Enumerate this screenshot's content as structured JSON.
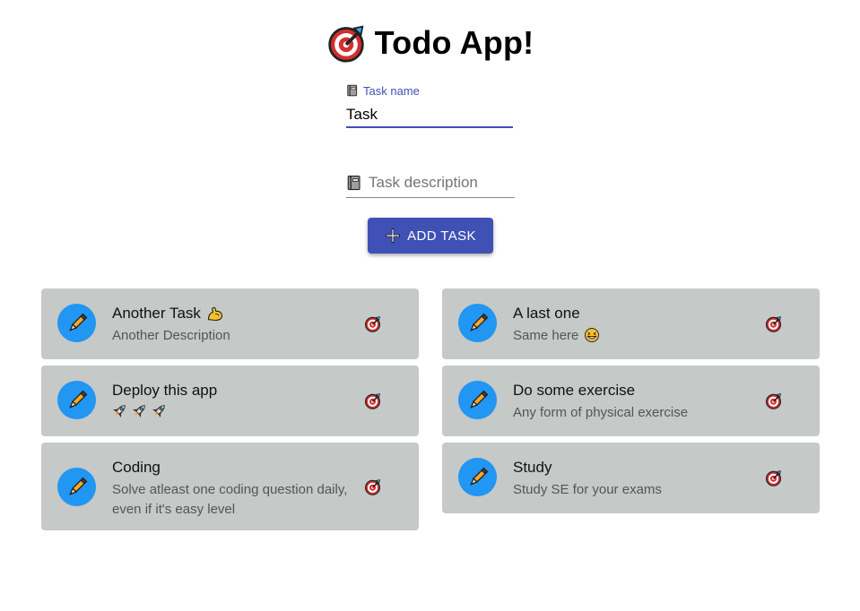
{
  "app": {
    "title": "Todo App!",
    "logo_icon": "target-dart-icon"
  },
  "form": {
    "name_label": "Task name",
    "name_value": "Task",
    "description_placeholder": "Task description",
    "field_icon": "notebook-icon",
    "add_button_label": "ADD TASK",
    "add_button_icon": "plus-icon"
  },
  "colors": {
    "primary": "#3f51b5",
    "avatar": "#2196f3",
    "card_bg": "#c5c9c7"
  },
  "tasks": [
    {
      "title": "Another Task",
      "title_emoji": "flexed-biceps-icon",
      "description": "Another Description",
      "action_icon": "target-dart-icon"
    },
    {
      "title": "A last one",
      "description": "Same here",
      "description_emoji": "grinning-squinting-face-icon",
      "action_icon": "target-dart-icon"
    },
    {
      "title": "Deploy this app",
      "description_emoji": "rocket-icon x3",
      "action_icon": "target-dart-icon"
    },
    {
      "title": "Do some exercise",
      "description": "Any form of physical exercise",
      "action_icon": "target-dart-icon"
    },
    {
      "title": "Coding",
      "description": "Solve atleast one coding question daily, even if it's easy level",
      "action_icon": "target-dart-icon"
    },
    {
      "title": "Study",
      "description": "Study SE for your exams",
      "action_icon": "target-dart-icon"
    }
  ],
  "task_avatar_icon": "pencil-icon"
}
